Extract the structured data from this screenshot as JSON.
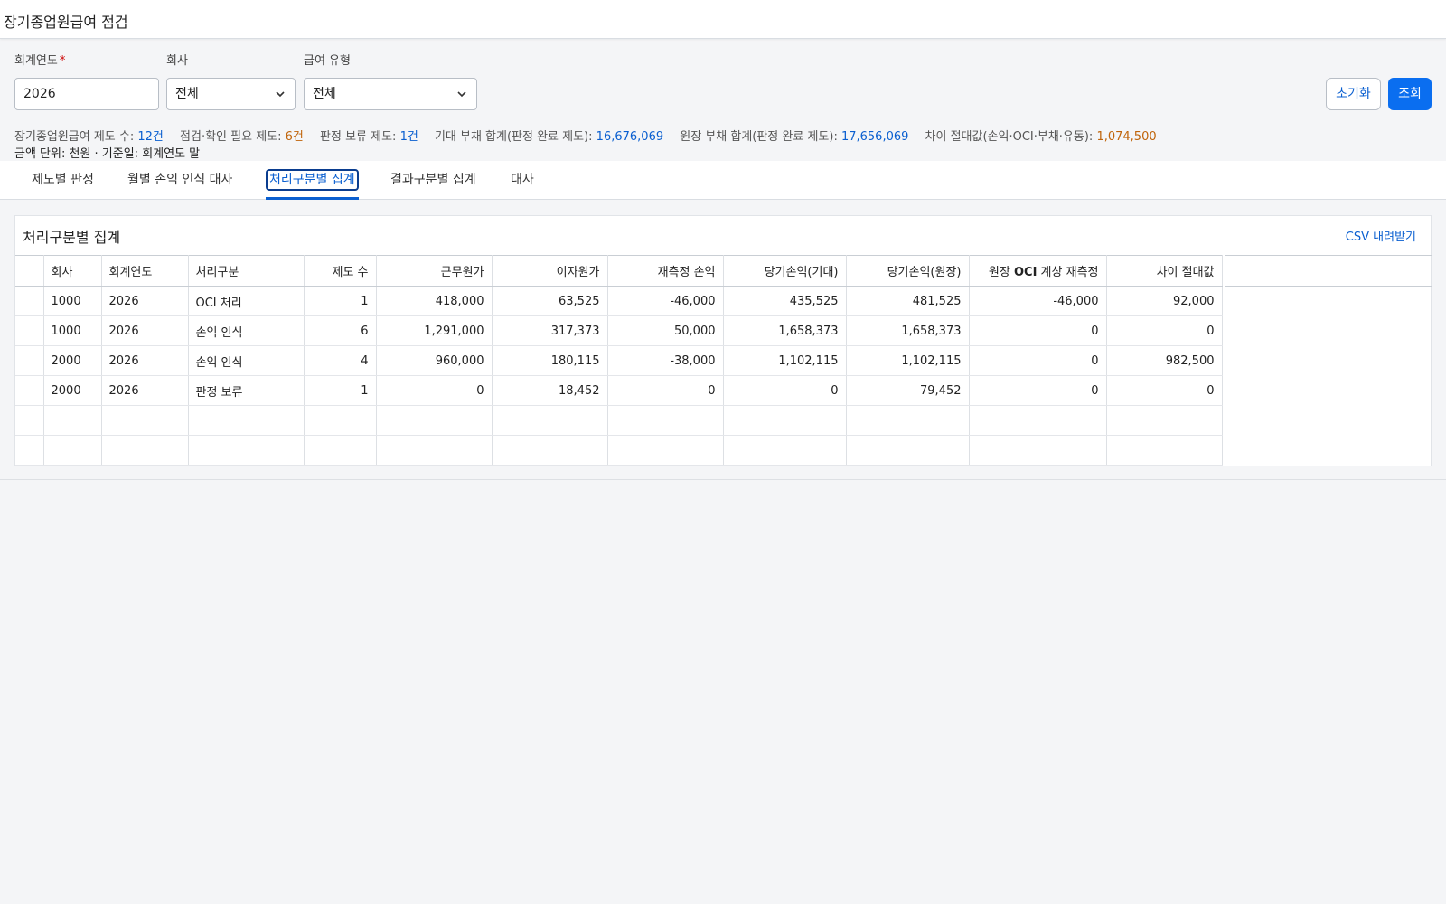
{
  "header": {
    "title": "장기종업원급여 점검"
  },
  "filters": {
    "fiscal_year": {
      "label": "회계연도",
      "required_mark": "*",
      "value": "2026"
    },
    "company": {
      "label": "회사",
      "value": "전체"
    },
    "pay_type": {
      "label": "급여 유형",
      "value": "전체"
    }
  },
  "buttons": {
    "reset": "초기화",
    "search": "조회"
  },
  "summary": {
    "plans_label": "장기종업원급여 제도 수:",
    "plans_value": "12건",
    "check_label": "점검·확인 필요 제도:",
    "check_value": "6건",
    "hold_label": "판정 보류 제도:",
    "hold_value": "1건",
    "expected_label": "기대 부채 합계(판정 완료 제도):",
    "expected_value": "16,676,069",
    "ledger_label": "원장 부채 합계(판정 완료 제도):",
    "ledger_value": "17,656,069",
    "diff_label": "차이 절대값(손익·OCI·부채·유동):",
    "diff_value": "1,074,500",
    "unit_note": "금액 단위: 천원 · 기준일: 회계연도 말"
  },
  "tabs": [
    {
      "label": "제도별 판정",
      "active": false
    },
    {
      "label": "월별 손익 인식 대사",
      "active": false
    },
    {
      "label": "처리구분별 집계",
      "active": true
    },
    {
      "label": "결과구분별 집계",
      "active": false
    },
    {
      "label": "대사",
      "active": false
    }
  ],
  "panel": {
    "title": "처리구분별 집계",
    "csv_label": "CSV 내려받기",
    "columns": {
      "company": "회사",
      "fiscal_year": "회계연도",
      "treatment": "처리구분",
      "plan_count": "제도 수",
      "service_cost": "근무원가",
      "interest_cost": "이자원가",
      "remeasurement": "재측정 손익",
      "pl_expected": "당기손익(기대)",
      "pl_ledger": "당기손익(원장)",
      "ledger_oci_prefix": "원장 ",
      "ledger_oci_bold": "OCI",
      "ledger_oci_suffix": " 계상 재측정",
      "abs_diff": "차이 절대값"
    },
    "rows": [
      [
        "1000",
        "2026",
        "OCI 처리",
        "1",
        "418,000",
        "63,525",
        "-46,000",
        "435,525",
        "481,525",
        "-46,000",
        "92,000"
      ],
      [
        "1000",
        "2026",
        "손익 인식",
        "6",
        "1,291,000",
        "317,373",
        "50,000",
        "1,658,373",
        "1,658,373",
        "0",
        "0"
      ],
      [
        "2000",
        "2026",
        "손익 인식",
        "4",
        "960,000",
        "180,115",
        "-38,000",
        "1,102,115",
        "1,102,115",
        "0",
        "982,500"
      ],
      [
        "2000",
        "2026",
        "판정 보류",
        "1",
        "0",
        "18,452",
        "0",
        "0",
        "79,452",
        "0",
        "0"
      ],
      [
        "",
        "",
        "",
        "",
        "",
        "",
        "",
        "",
        "",
        "",
        ""
      ],
      [
        "",
        "",
        "",
        "",
        "",
        "",
        "",
        "",
        "",
        "",
        ""
      ]
    ]
  }
}
